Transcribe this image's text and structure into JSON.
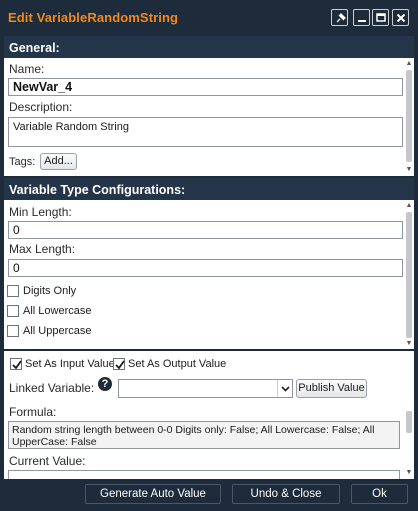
{
  "window": {
    "title": "Edit VariableRandomString",
    "controls": [
      "pin-icon",
      "minimize-icon",
      "maximize-icon",
      "close-icon"
    ]
  },
  "general": {
    "header": "General:",
    "name_label": "Name:",
    "name_value": "NewVar_4",
    "description_label": "Description:",
    "description_value": "Variable Random String",
    "tags_label": "Tags:",
    "add_label": "Add..."
  },
  "config": {
    "header": "Variable Type Configurations:",
    "min_label": "Min Length:",
    "min_value": "0",
    "max_label": "Max Length:",
    "max_value": "0",
    "checkboxes": [
      {
        "label": "Digits Only",
        "checked": false
      },
      {
        "label": "All Lowercase",
        "checked": false
      },
      {
        "label": "All Uppercase",
        "checked": false
      }
    ]
  },
  "io": {
    "input_label": "Set As Input Value",
    "input_checked": true,
    "output_label": "Set As Output Value",
    "output_checked": true,
    "linked_label": "Linked Variable:",
    "linked_value": "",
    "publish_label": "Publish Value",
    "formula_label": "Formula:",
    "formula_value": "Random string length between 0-0 Digits only: False; All Lowercase: False; All UpperCase: False",
    "current_label": "Current Value:"
  },
  "footer": {
    "generate_label": "Generate Auto Value",
    "undo_label": "Undo & Close",
    "ok_label": "Ok"
  },
  "colors": {
    "title_bar": "#1e2b3b",
    "title_text": "#f08a1c",
    "section_header": "#24354a"
  }
}
